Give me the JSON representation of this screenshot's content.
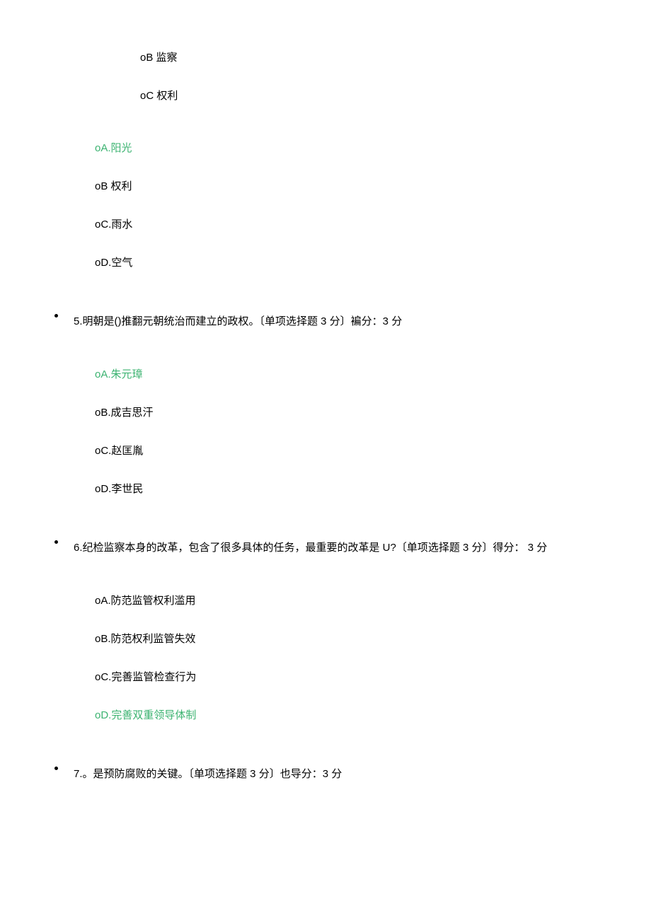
{
  "partialOptions1": {
    "b": "oB 监察",
    "c": "oC 权利"
  },
  "q4options": {
    "a": "oA.阳光",
    "b": "oB 权利",
    "c": "oC.雨水",
    "d": "oD.空气"
  },
  "q5": {
    "text": "5.明朝是()推翻元朝统治而建立的政权。〔单项选择题 3 分〕褊分：3 分",
    "options": {
      "a": "oA.朱元璋",
      "b": "oB.成吉思汗",
      "c": "oC.赵匡胤",
      "d": "oD.李世民"
    }
  },
  "q6": {
    "text": "6.纪检监察本身的改革，包含了很多具体的任务，最重要的改革是 U?〔单项选择题 3 分〕得分： 3 分",
    "options": {
      "a": "oA.防范监管权利滥用",
      "b": "oB.防范权利监管失效",
      "c": "oC.完善监管检查行为",
      "d": "oD.完善双重领导体制"
    }
  },
  "q7": {
    "text": "7.。是预防腐败的关键。〔单项选择题 3 分〕也导分：3 分"
  }
}
